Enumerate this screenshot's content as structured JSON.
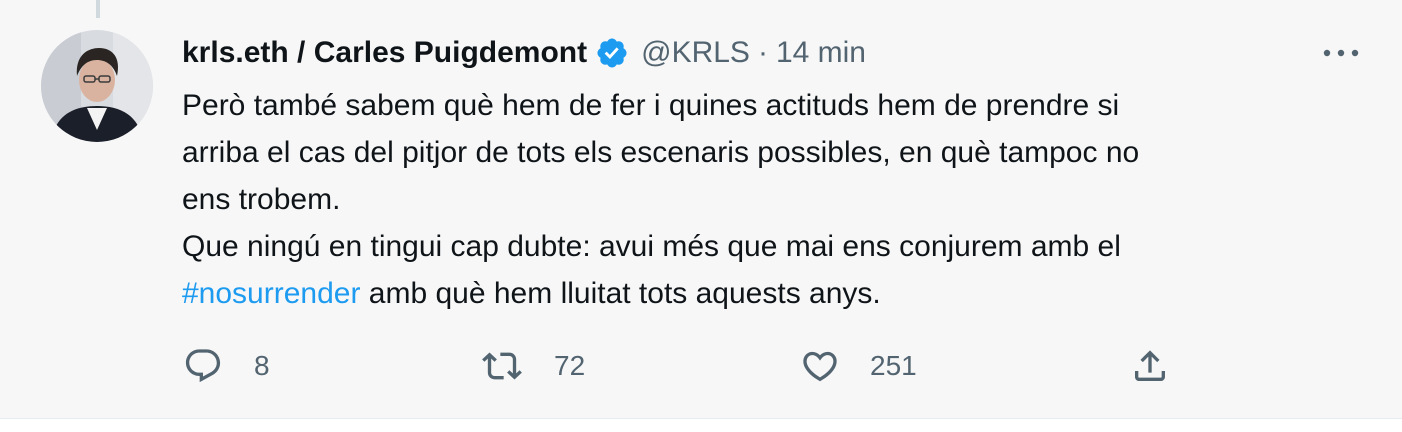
{
  "tweet": {
    "display_name": "krls.eth / Carles Puigdemont",
    "handle": "@KRLS",
    "separator": "·",
    "timestamp": "14 min",
    "body": {
      "line1": "Però també sabem què hem de fer i quines actituds hem de prendre si",
      "line2": "arriba el cas del pitjor de tots els escenaris possibles, en què tampoc no",
      "line3": "ens trobem.",
      "line4": "Que ningú en tingui cap dubte: avui més que mai ens conjurem amb el",
      "hashtag": "#nosurrender",
      "line5_rest": " amb què hem lluitat tots aquests anys."
    },
    "actions": {
      "reply_count": "8",
      "retweet_count": "72",
      "like_count": "251"
    }
  },
  "icons": {
    "verified": "verified-badge-icon",
    "more": "more-options-icon",
    "reply": "reply-icon",
    "retweet": "retweet-icon",
    "like": "heart-icon",
    "share": "share-icon"
  },
  "colors": {
    "background": "#f7f7f7",
    "text": "#0f1419",
    "secondary_text": "#536471",
    "accent": "#1d9bf0"
  }
}
